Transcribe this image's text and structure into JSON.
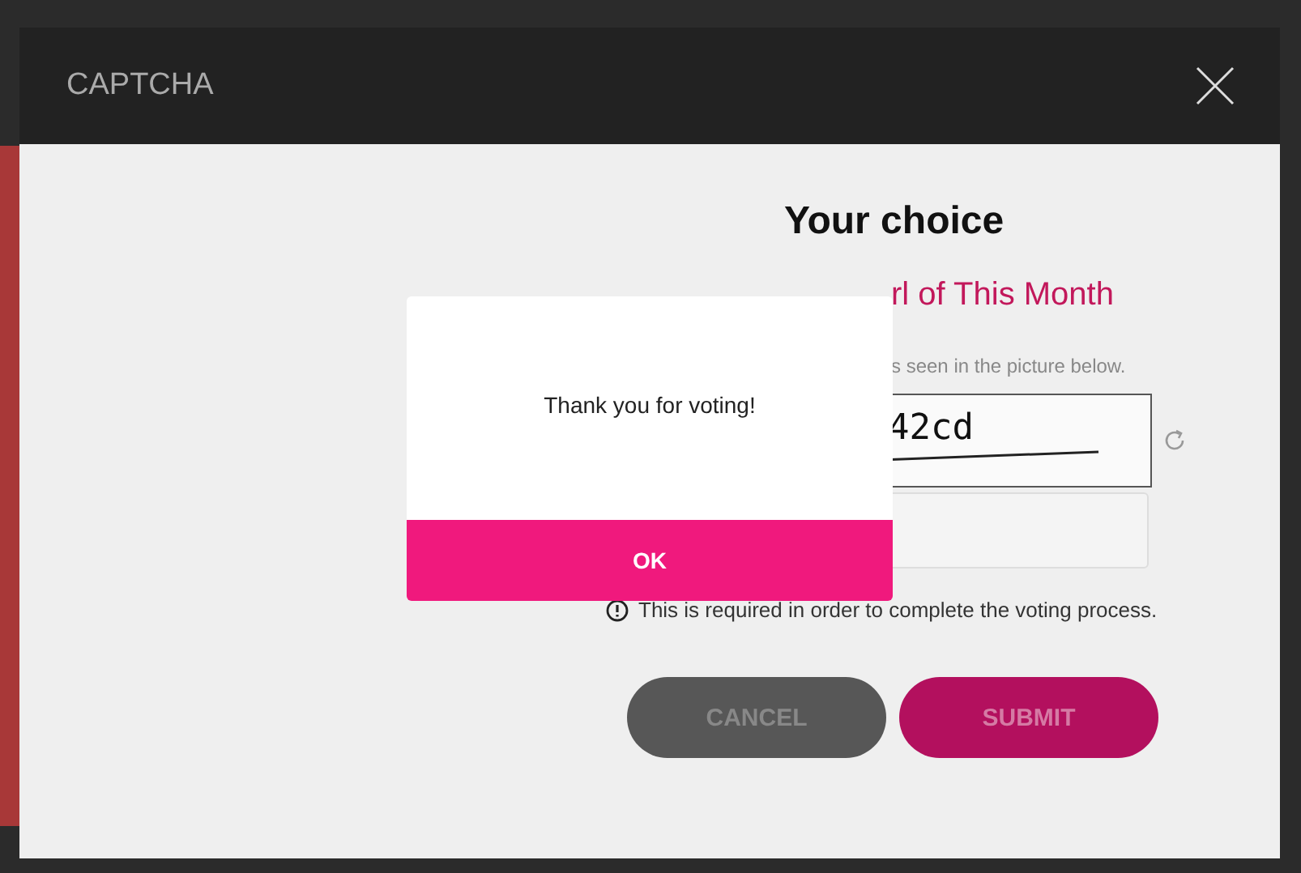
{
  "modal": {
    "title": "CAPTCHA"
  },
  "form": {
    "heading": "Your choice",
    "category": "rl of This Month",
    "instruction": "s seen in the picture below.",
    "captcha_text": "42cd",
    "note": "This is required in order to complete the voting process.",
    "buttons": [
      {
        "label": "CANCEL",
        "kind": "cancel"
      },
      {
        "label": "SUBMIT",
        "kind": "submit"
      }
    ]
  },
  "alert": {
    "message": "Thank you for voting!",
    "button": "OK"
  }
}
